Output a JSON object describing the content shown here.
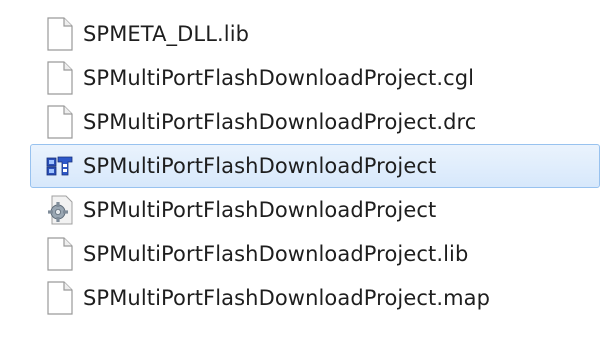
{
  "files": [
    {
      "name": "SPMETA_DLL.lib",
      "icon": "blank-file-icon",
      "selected": false
    },
    {
      "name": "SPMultiPortFlashDownloadProject.cgl",
      "icon": "blank-file-icon",
      "selected": false
    },
    {
      "name": "SPMultiPortFlashDownloadProject.drc",
      "icon": "blank-file-icon",
      "selected": false
    },
    {
      "name": "SPMultiPortFlashDownloadProject",
      "icon": "application-icon",
      "selected": true
    },
    {
      "name": "SPMultiPortFlashDownloadProject",
      "icon": "config-gear-file-icon",
      "selected": false
    },
    {
      "name": "SPMultiPortFlashDownloadProject.lib",
      "icon": "blank-file-icon",
      "selected": false
    },
    {
      "name": "SPMultiPortFlashDownloadProject.map",
      "icon": "blank-file-icon",
      "selected": false
    }
  ],
  "colors": {
    "selection_fill": "#d7e8fb",
    "selection_border": "#98c2ef"
  }
}
